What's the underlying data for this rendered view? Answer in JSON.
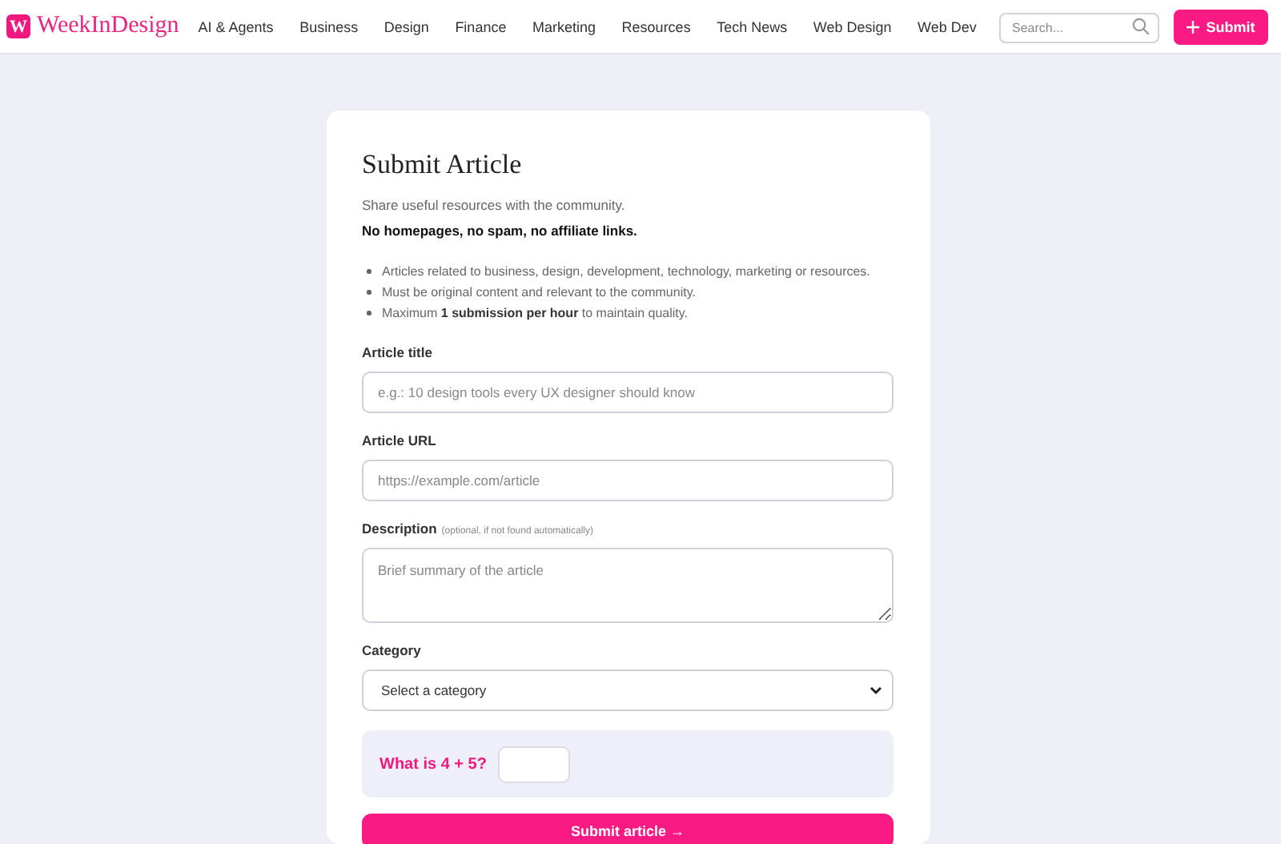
{
  "header": {
    "logo_mark": "W",
    "brand": "WeekInDesign",
    "nav": [
      "AI & Agents",
      "Business",
      "Design",
      "Finance",
      "Marketing",
      "Resources",
      "Tech News",
      "Web Design",
      "Web Dev"
    ],
    "search": {
      "placeholder": "Search..."
    },
    "submit_button": "Submit"
  },
  "form": {
    "title": "Submit Article",
    "intro": "Share useful resources with the community.",
    "rule": "No homepages, no spam, no affiliate links.",
    "guidelines": [
      "Articles related to business, design, development, technology, marketing or resources.",
      "Must be original content and relevant to the community.",
      "Maximum **1 submission per hour** to maintain quality."
    ],
    "fields": [
      {
        "kind": "text",
        "label": "Article title",
        "placeholder": "e.g.: 10 design tools every UX designer should know"
      },
      {
        "kind": "text",
        "label": "Article URL",
        "placeholder": "https://example.com/article"
      },
      {
        "kind": "textarea",
        "label": "Description",
        "note": "(optional, if not found automatically)",
        "placeholder": "Brief summary of the article"
      },
      {
        "kind": "select",
        "label": "Category",
        "value": "Select a category"
      }
    ],
    "captcha": {
      "question": "What is 4 + 5?"
    },
    "submit": "Submit article →"
  }
}
